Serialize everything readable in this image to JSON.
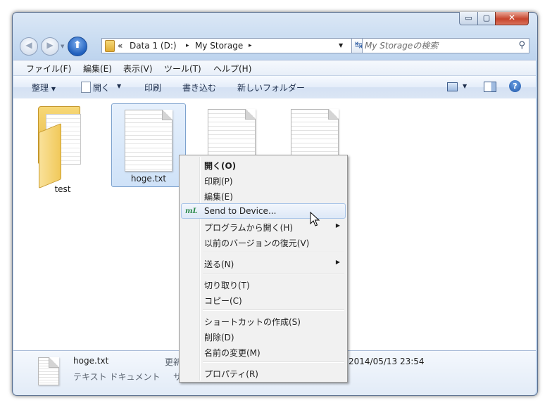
{
  "window": {
    "controls": {
      "minimize": "▭",
      "maximize": "▢",
      "close": "✕"
    }
  },
  "nav": {
    "back": "◀",
    "forward": "▶",
    "up": "⬆",
    "dropdown": "▼"
  },
  "address": {
    "overflow": "«",
    "segments": [
      "Data 1 (D:)",
      "My Storage"
    ],
    "separator": "▸",
    "dropdown": "▼",
    "refresh": "↹"
  },
  "search": {
    "placeholder": "My Storageの検索",
    "icon": "search-icon"
  },
  "menubar": [
    "ファイル(F)",
    "編集(E)",
    "表示(V)",
    "ツール(T)",
    "ヘルプ(H)"
  ],
  "toolbar": {
    "organize": "整理",
    "open": "開く",
    "print": "印刷",
    "burn": "書き込む",
    "new_folder": "新しいフォルダー",
    "dropdown": "▼",
    "help": "?"
  },
  "items": [
    {
      "name": "test",
      "type": "folder",
      "selected": false
    },
    {
      "name": "hoge.txt",
      "type": "text",
      "selected": true
    },
    {
      "name": "",
      "type": "text",
      "selected": false
    },
    {
      "name": "",
      "type": "text",
      "selected": false
    }
  ],
  "details": {
    "filename": "hoge.txt",
    "filetype": "テキスト ドキュメント",
    "modified_label": "更新",
    "size_label": "サ",
    "date": "2014/05/13 23:54"
  },
  "context_menu": {
    "items": [
      {
        "label": "開く(O)",
        "bold": true
      },
      {
        "label": "印刷(P)"
      },
      {
        "label": "編集(E)"
      },
      {
        "label": "Send to Device...",
        "icon": "mL",
        "hover": true
      },
      {
        "label": "プログラムから開く(H)",
        "submenu": true
      },
      {
        "label": "以前のバージョンの復元(V)"
      },
      {
        "label": "送る(N)",
        "submenu": true
      },
      {
        "label": "切り取り(T)"
      },
      {
        "label": "コピー(C)"
      },
      {
        "label": "ショートカットの作成(S)"
      },
      {
        "label": "削除(D)"
      },
      {
        "label": "名前の変更(M)"
      },
      {
        "label": "プロパティ(R)"
      }
    ],
    "submenu_arrow": "▶"
  }
}
